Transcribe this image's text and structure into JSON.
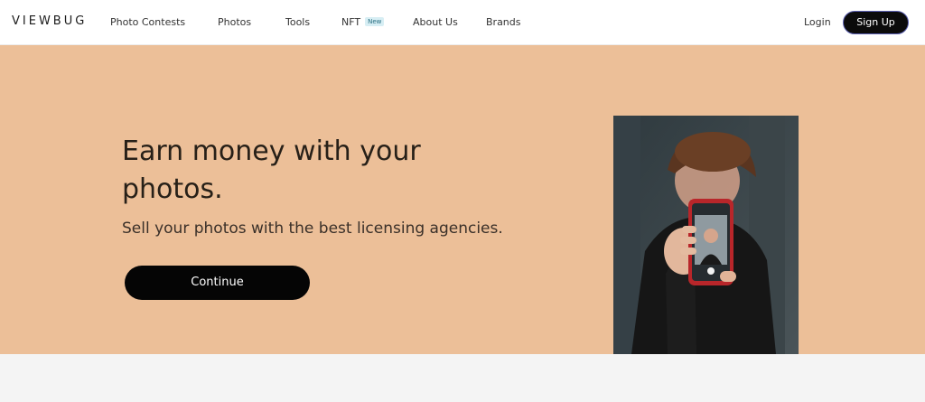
{
  "brand": {
    "logo": "VIEWBUG"
  },
  "nav": {
    "items": [
      {
        "label": "Photo Contests"
      },
      {
        "label": "Photos"
      },
      {
        "label": "Tools"
      },
      {
        "label": "NFT",
        "badge": "New"
      },
      {
        "label": "About Us"
      },
      {
        "label": "Brands"
      }
    ],
    "login": "Login",
    "signup": "Sign Up"
  },
  "hero": {
    "headline": "Earn money with your photos.",
    "subtitle": "Sell your photos with the best licensing agencies.",
    "cta": "Continue",
    "image_icon": "person-holding-phone-photo"
  },
  "colors": {
    "hero_bg": "#ecbf98",
    "cta_bg": "#050505",
    "page_bg": "#f4f4f4",
    "badge_bg": "#d7eef4"
  }
}
